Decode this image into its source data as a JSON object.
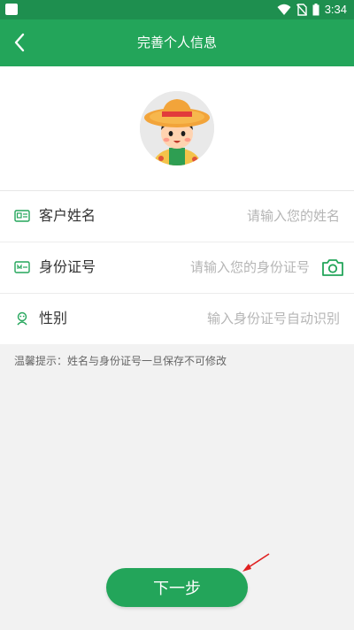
{
  "status_bar": {
    "time": "3:34",
    "icons": [
      "app-icon",
      "wifi-icon",
      "no-sim-icon",
      "battery-icon"
    ]
  },
  "header": {
    "title": "完善个人信息",
    "back_icon": "chevron-left-icon"
  },
  "profile": {
    "avatar": "farmer-avatar"
  },
  "form": {
    "rows": [
      {
        "label": "客户姓名",
        "placeholder": "请输入您的姓名",
        "value": "",
        "icon": "id-card-icon"
      },
      {
        "label": "身份证号",
        "placeholder": "请输入您的身份证号",
        "value": "",
        "icon": "id-number-icon",
        "action_icon": "camera-icon"
      },
      {
        "label": "性别",
        "placeholder": "输入身份证号自动识别",
        "value": "",
        "icon": "person-icon"
      }
    ]
  },
  "tip": "温馨提示：姓名与身份证号一旦保存不可修改",
  "next_button": {
    "label": "下一步"
  },
  "colors": {
    "status_bar": "#1e8f4f",
    "primary": "#23a55a",
    "background": "#f2f2f2",
    "annotation_arrow": "#e02020"
  }
}
